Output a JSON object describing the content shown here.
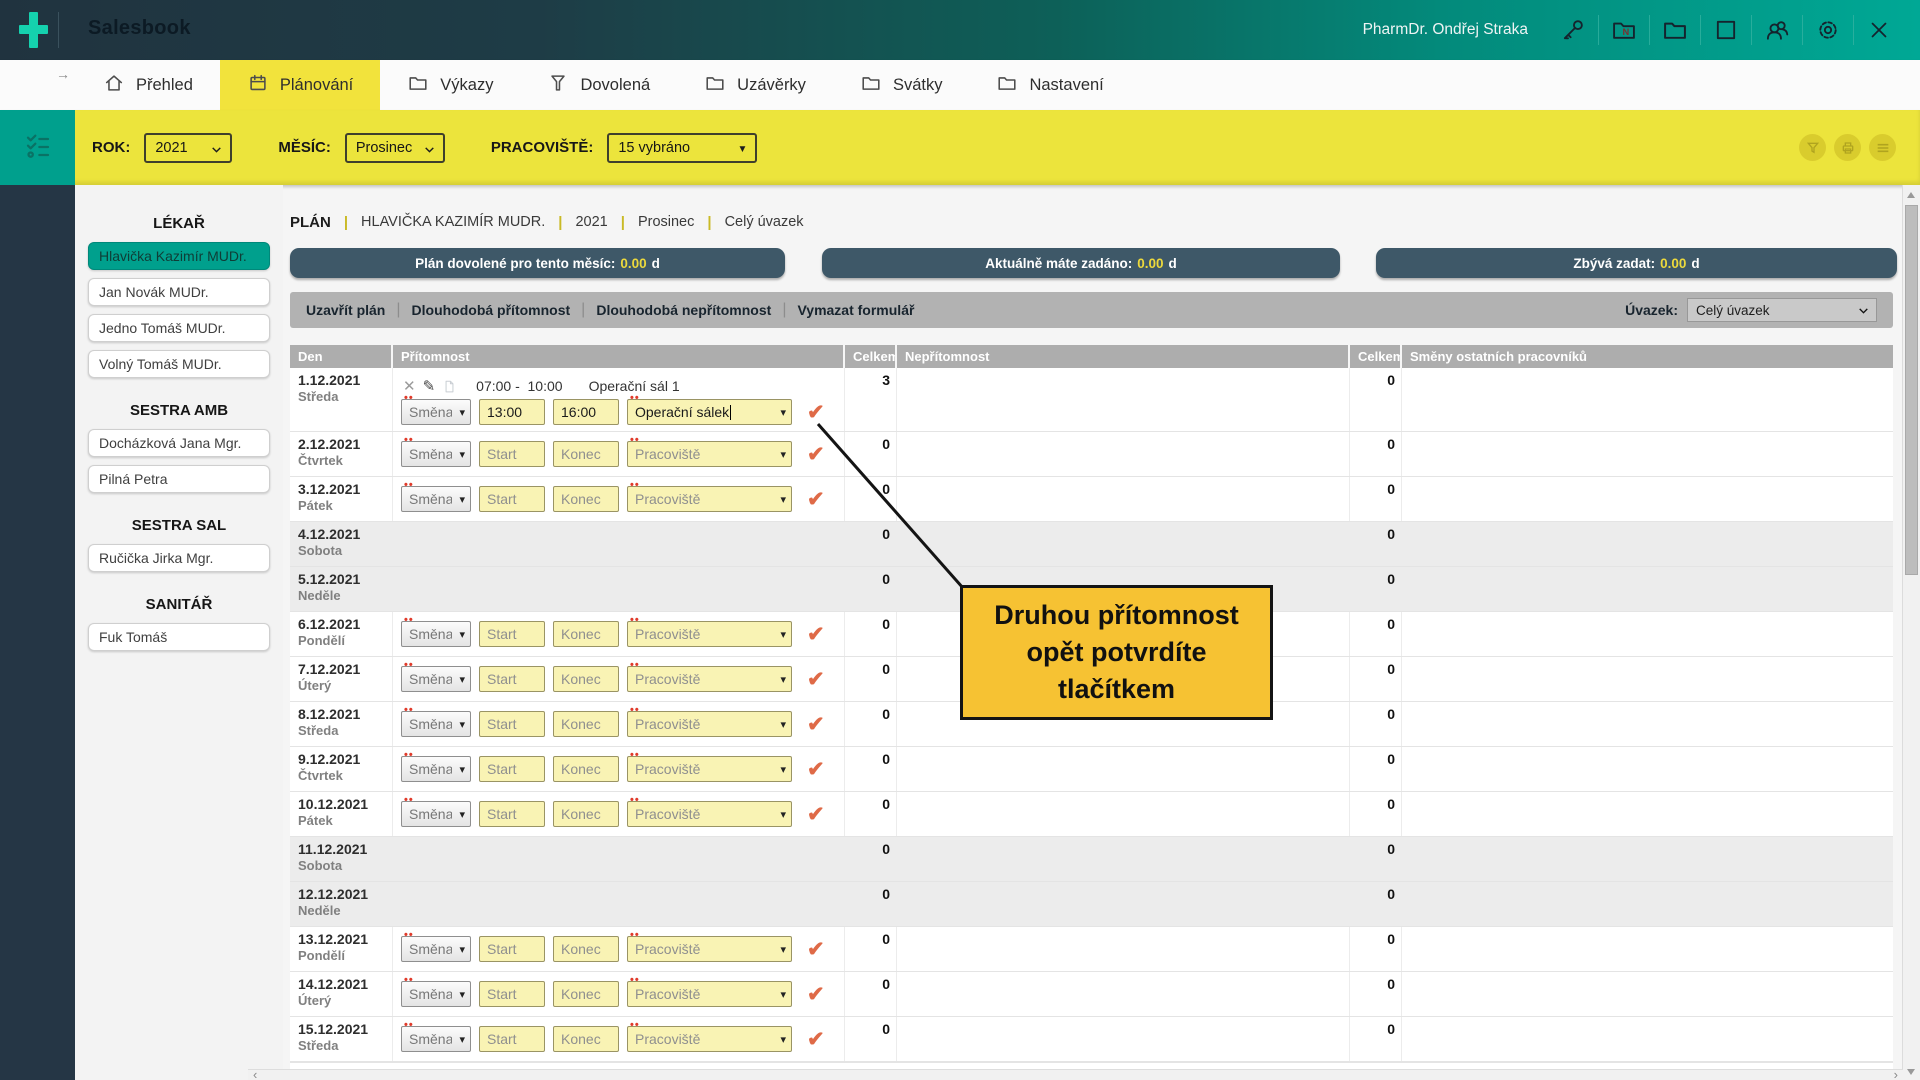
{
  "header": {
    "app_title": "Salesbook",
    "user_name": "PharmDr. Ondřej Straka",
    "icons": [
      "key-icon",
      "folder-n-icon",
      "folder-icon",
      "maximize-icon",
      "users-icon",
      "settings-icon",
      "close-icon"
    ]
  },
  "nav": {
    "back_arrow": "→",
    "tabs": [
      {
        "label": "Přehled",
        "icon": "home-icon",
        "active": false
      },
      {
        "label": "Plánování",
        "icon": "calendar-icon",
        "active": true
      },
      {
        "label": "Výkazy",
        "icon": "folder-icon",
        "active": false
      },
      {
        "label": "Dovolená",
        "icon": "funnel-icon",
        "active": false
      },
      {
        "label": "Uzávěrky",
        "icon": "folder-icon",
        "active": false
      },
      {
        "label": "Svátky",
        "icon": "folder-icon",
        "active": false
      },
      {
        "label": "Nastavení",
        "icon": "folder-icon",
        "active": false
      }
    ]
  },
  "filters": {
    "rok": {
      "label": "ROK:",
      "value": "2021"
    },
    "mesic": {
      "label": "MĚSÍC:",
      "value": "Prosinec"
    },
    "pracoviste": {
      "label": "PRACOVIŠTĚ:",
      "value": "15 vybráno"
    },
    "buttons": [
      "filter-icon",
      "print-icon",
      "menu-icon"
    ]
  },
  "sidebar": {
    "sections": [
      {
        "title": "LÉKAŘ",
        "items": [
          {
            "label": "Hlavička Kazimír MUDr.",
            "selected": true
          },
          {
            "label": "Jan Novák MUDr.",
            "selected": false
          },
          {
            "label": "Jedno Tomáš MUDr.",
            "selected": false
          },
          {
            "label": "Volný Tomáš MUDr.",
            "selected": false
          }
        ]
      },
      {
        "title": "SESTRA AMB",
        "items": [
          {
            "label": "Docházková Jana Mgr.",
            "selected": false
          },
          {
            "label": "Pilná Petra",
            "selected": false
          }
        ]
      },
      {
        "title": "SESTRA SAL",
        "items": [
          {
            "label": "Ručička Jirka Mgr.",
            "selected": false
          }
        ]
      },
      {
        "title": "SANITÁŘ",
        "items": [
          {
            "label": "Fuk Tomáš",
            "selected": false
          }
        ]
      }
    ]
  },
  "plan": {
    "breadcrumb": [
      "PLÁN",
      "HLAVIČKA KAZIMÍR MUDR.",
      "2021",
      "Prosinec",
      "Celý úvazek"
    ],
    "pills": [
      {
        "label": "Plán dovolené pro tento měsíc:",
        "value": "0.00",
        "unit": "d"
      },
      {
        "label": "Aktuálně máte zadáno:",
        "value": "0.00",
        "unit": "d"
      },
      {
        "label": "Zbývá zadat:",
        "value": "0.00",
        "unit": "d"
      }
    ],
    "toolbar": {
      "actions": [
        "Uzavřít plán",
        "Dlouhodobá přítomnost",
        "Dlouhodobá nepřítomnost",
        "Vymazat formulář"
      ],
      "uvazek_label": "Úvazek:",
      "uvazek_value": "Celý úvazek"
    },
    "table": {
      "headers": [
        "Den",
        "Přítomnost",
        "Celkem",
        "Nepřítomnost",
        "Celkem",
        "Směny ostatních pracovníků"
      ],
      "placeholders": {
        "smena": "Směna",
        "start": "Start",
        "konec": "Konec",
        "pracoviste": "Pracoviště"
      },
      "rows": [
        {
          "date": "1.12.2021",
          "day": "Středa",
          "type": "work",
          "celkem": "3",
          "celkem2": "0",
          "entry": {
            "time": "07:00 -  10:00",
            "place": "Operační sál 1"
          },
          "fields": {
            "smena": "Směna",
            "start": "13:00",
            "konec": "16:00",
            "pracoviste": "Operační sálek"
          }
        },
        {
          "date": "2.12.2021",
          "day": "Čtvrtek",
          "type": "work",
          "celkem": "0",
          "celkem2": "0"
        },
        {
          "date": "3.12.2021",
          "day": "Pátek",
          "type": "work",
          "celkem": "0",
          "celkem2": "0"
        },
        {
          "date": "4.12.2021",
          "day": "Sobota",
          "type": "weekend",
          "celkem": "0",
          "celkem2": "0"
        },
        {
          "date": "5.12.2021",
          "day": "Neděle",
          "type": "weekend",
          "celkem": "0",
          "celkem2": "0"
        },
        {
          "date": "6.12.2021",
          "day": "Pondělí",
          "type": "work",
          "celkem": "0",
          "celkem2": "0"
        },
        {
          "date": "7.12.2021",
          "day": "Úterý",
          "type": "work",
          "celkem": "0",
          "celkem2": "0"
        },
        {
          "date": "8.12.2021",
          "day": "Středa",
          "type": "work",
          "celkem": "0",
          "celkem2": "0"
        },
        {
          "date": "9.12.2021",
          "day": "Čtvrtek",
          "type": "work",
          "celkem": "0",
          "celkem2": "0"
        },
        {
          "date": "10.12.2021",
          "day": "Pátek",
          "type": "work",
          "celkem": "0",
          "celkem2": "0"
        },
        {
          "date": "11.12.2021",
          "day": "Sobota",
          "type": "weekend",
          "celkem": "0",
          "celkem2": "0"
        },
        {
          "date": "12.12.2021",
          "day": "Neděle",
          "type": "weekend",
          "celkem": "0",
          "celkem2": "0"
        },
        {
          "date": "13.12.2021",
          "day": "Pondělí",
          "type": "work",
          "celkem": "0",
          "celkem2": "0"
        },
        {
          "date": "14.12.2021",
          "day": "Úterý",
          "type": "work",
          "celkem": "0",
          "celkem2": "0"
        },
        {
          "date": "15.12.2021",
          "day": "Středa",
          "type": "work",
          "celkem": "0",
          "celkem2": "0"
        }
      ]
    }
  },
  "callout": {
    "text": "Druhou přítomnost opět potvrdíte tlačítkem"
  },
  "colors": {
    "header_gradient_left": "#20333f",
    "header_gradient_right": "#00a895",
    "accent_teal": "#00a08d",
    "nav_active_yellow": "#f2e33c",
    "filter_yellow": "#ece43c",
    "left_strip": "#253645",
    "pill_bg": "#3e5868",
    "pill_value": "#ecd93c",
    "toolbar_bg": "#b2b2b2",
    "table_header_bg": "#adadad",
    "weekend_row": "#ececec",
    "field_yellow": "#f9f3b4",
    "check_orange": "#df6a47",
    "callout_bg": "#f6c233",
    "breadcrumb_separator": "#c9ba26"
  }
}
